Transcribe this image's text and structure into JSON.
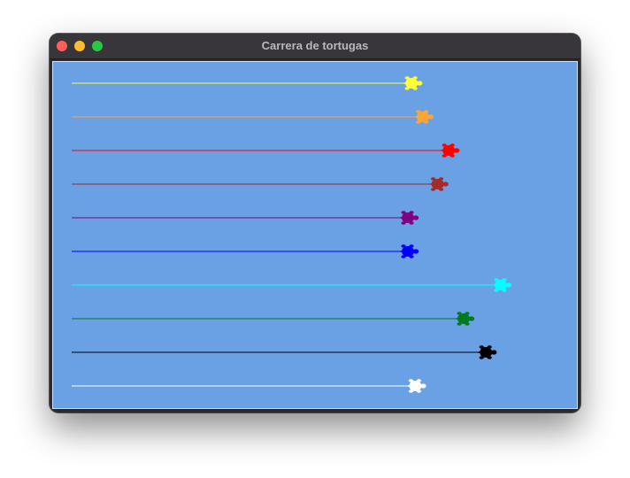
{
  "window": {
    "title": "Carrera de tortugas"
  },
  "race": {
    "background_color": "#6aa0e4",
    "turtles": [
      {
        "color": "yellow",
        "hex": "#ffff33",
        "progress": 0.91
      },
      {
        "color": "orange",
        "hex": "#ffa533",
        "progress": 0.94
      },
      {
        "color": "red",
        "hex": "#ff0000",
        "progress": 1.01
      },
      {
        "color": "brown",
        "hex": "#a52a2a",
        "progress": 0.98
      },
      {
        "color": "purple",
        "hex": "#800080",
        "progress": 0.9
      },
      {
        "color": "blue",
        "hex": "#0000ff",
        "progress": 0.9
      },
      {
        "color": "cyan",
        "hex": "#00ffff",
        "progress": 1.15
      },
      {
        "color": "green",
        "hex": "#007a1f",
        "progress": 1.05
      },
      {
        "color": "black",
        "hex": "#000000",
        "progress": 1.11
      },
      {
        "color": "white",
        "hex": "#ffffff",
        "progress": 0.92
      }
    ]
  }
}
